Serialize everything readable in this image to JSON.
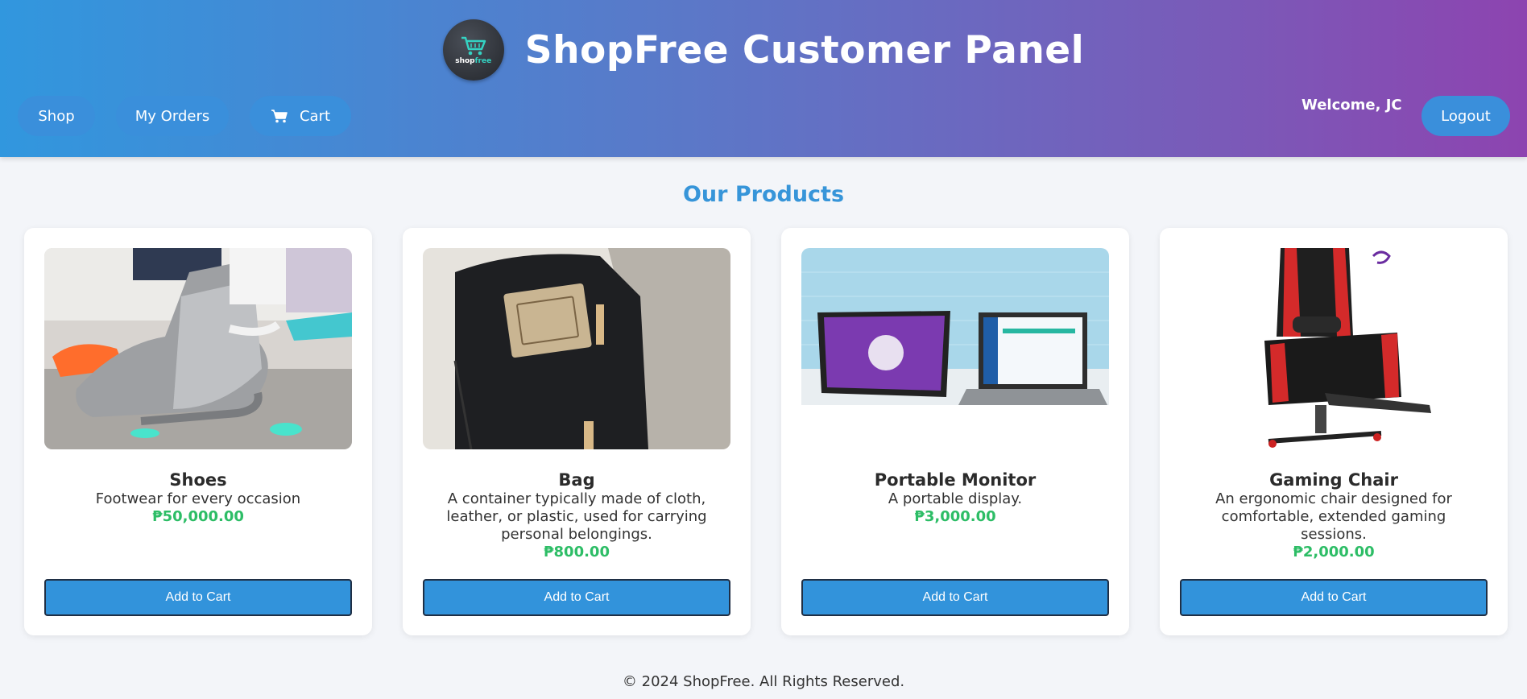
{
  "header": {
    "title": "ShopFree Customer Panel",
    "logo_text_shop": "shop",
    "logo_text_free": "free",
    "nav": [
      {
        "label": "Shop"
      },
      {
        "label": "My Orders"
      },
      {
        "label": "Cart",
        "icon": "cart-icon"
      }
    ],
    "welcome": "Welcome, JC",
    "logout": "Logout"
  },
  "main": {
    "section_title": "Our Products",
    "products": [
      {
        "name": "Shoes",
        "description": "Footwear for every occasion",
        "price": "₱50,000.00",
        "button": "Add to Cart",
        "image": "sneakers-photo"
      },
      {
        "name": "Bag",
        "description": "A container typically made of cloth, leather, or plastic, used for carrying personal belongings.",
        "price": "₱800.00",
        "button": "Add to Cart",
        "image": "backpack-photo"
      },
      {
        "name": "Portable Monitor",
        "description": "A portable display.",
        "price": "₱3,000.00",
        "button": "Add to Cart",
        "image": "monitor-laptop-photo"
      },
      {
        "name": "Gaming Chair",
        "description": "An ergonomic chair designed for comfortable, extended gaming sessions.",
        "price": "₱2,000.00",
        "button": "Add to Cart",
        "image": "gaming-chair-photo"
      }
    ]
  },
  "footer": {
    "text": "© 2024 ShopFree. All Rights Reserved."
  },
  "colors": {
    "accent": "#3293db",
    "price": "#2dbd66",
    "title": "#3795d9",
    "gradient_start": "#3197de",
    "gradient_end": "#8d44b0"
  }
}
